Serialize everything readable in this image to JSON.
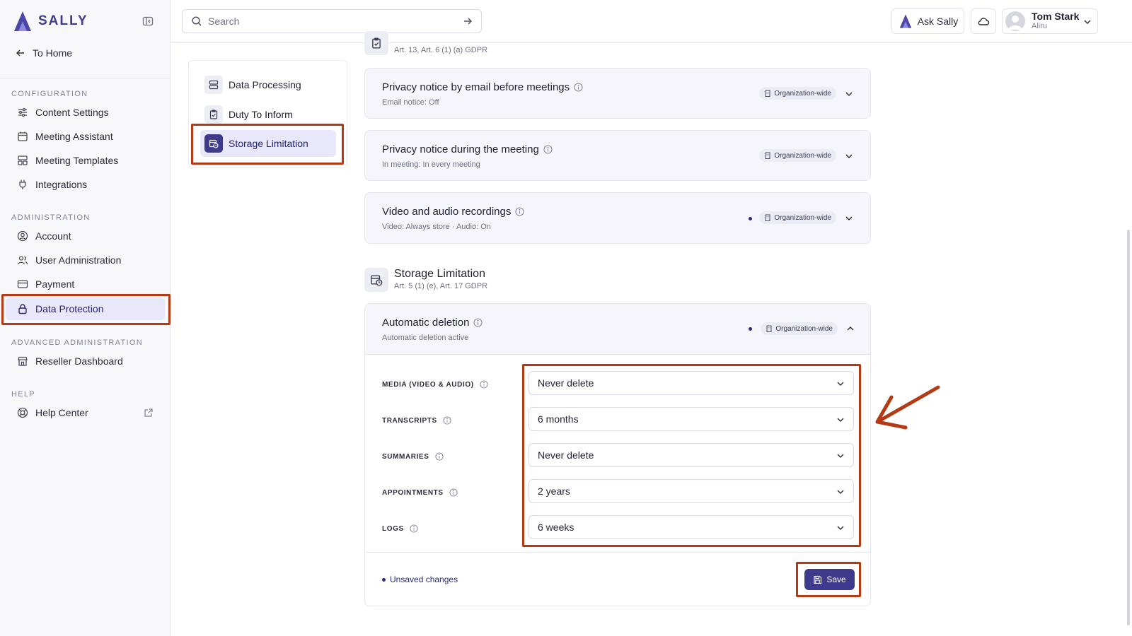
{
  "brand": {
    "name": "SALLY"
  },
  "nav": {
    "to_home": "To Home",
    "sections": [
      {
        "label": "CONFIGURATION"
      },
      {
        "label": "ADMINISTRATION"
      },
      {
        "label": "ADVANCED ADMINISTRATION"
      },
      {
        "label": "HELP"
      }
    ],
    "items": [
      {
        "label": "Content Settings",
        "icon": "sliders-icon"
      },
      {
        "label": "Meeting Assistant",
        "icon": "calendar-icon"
      },
      {
        "label": "Meeting Templates",
        "icon": "template-icon"
      },
      {
        "label": "Integrations",
        "icon": "plug-icon"
      },
      {
        "label": "Account",
        "icon": "user-circle-icon"
      },
      {
        "label": "User Administration",
        "icon": "users-icon"
      },
      {
        "label": "Payment",
        "icon": "credit-card-icon"
      },
      {
        "label": "Data Protection",
        "icon": "lock-icon",
        "active": true
      },
      {
        "label": "Reseller Dashboard",
        "icon": "store-icon"
      },
      {
        "label": "Help Center",
        "icon": "lifebuoy-icon"
      }
    ]
  },
  "topbar": {
    "search_placeholder": "Search",
    "ask_label": "Ask Sally",
    "user_name": "Tom Stark",
    "user_org": "Aliru"
  },
  "subnav": {
    "items": [
      {
        "label": "Data Processing"
      },
      {
        "label": "Duty To Inform"
      },
      {
        "label": "Storage Limitation",
        "active": true
      }
    ]
  },
  "duty_section": {
    "sub": "Art. 13, Art. 6 (1) (a) GDPR"
  },
  "cards": [
    {
      "title": "Privacy notice by email before meetings",
      "sub": "Email notice: Off",
      "badge": "Organization-wide",
      "dot": false
    },
    {
      "title": "Privacy notice during the meeting",
      "sub": "In meeting: In every meeting",
      "badge": "Organization-wide",
      "dot": false
    },
    {
      "title": "Video and audio recordings",
      "sub": "Video: Always store · Audio: On",
      "badge": "Organization-wide",
      "dot": true
    }
  ],
  "storage_section": {
    "title": "Storage Limitation",
    "sub": "Art. 5 (1) (e), Art. 17 GDPR"
  },
  "auto_deletion": {
    "title": "Automatic deletion",
    "sub": "Automatic deletion active",
    "badge": "Organization-wide",
    "fields": [
      {
        "label": "Media (Video & Audio)",
        "value": "Never delete"
      },
      {
        "label": "Transcripts",
        "value": "6 months"
      },
      {
        "label": "Summaries",
        "value": "Never delete"
      },
      {
        "label": "Appointments",
        "value": "2 years"
      },
      {
        "label": "Logs",
        "value": "6 weeks"
      }
    ],
    "unsaved_label": "Unsaved changes",
    "save_label": "Save"
  },
  "colors": {
    "accent": "#3f3a8c",
    "active_bg": "#e9e8fa",
    "annotation": "#b33a15"
  }
}
